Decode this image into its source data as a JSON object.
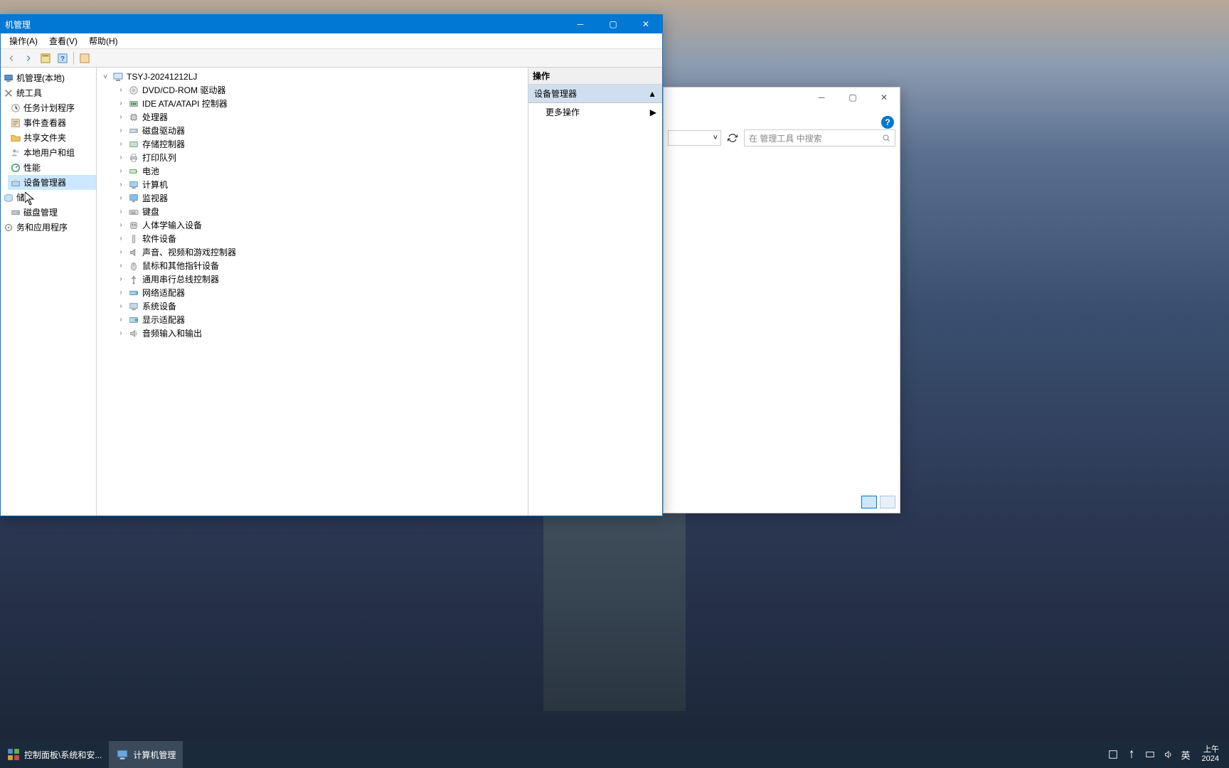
{
  "window": {
    "title": "机管理",
    "menus": {
      "action": "操作(A)",
      "view": "查看(V)",
      "help": "帮助(H)"
    }
  },
  "left_tree": {
    "root": "机管理(本地)",
    "sys_tools": "统工具",
    "items": [
      "任务计划程序",
      "事件查看器",
      "共享文件夹",
      "本地用户和组",
      "性能",
      "设备管理器"
    ],
    "storage": "储",
    "disk_mgmt": "磁盘管理",
    "services": "务和应用程序"
  },
  "device_tree": {
    "root": "TSYJ-20241212LJ",
    "categories": [
      "DVD/CD-ROM 驱动器",
      "IDE ATA/ATAPI 控制器",
      "处理器",
      "磁盘驱动器",
      "存储控制器",
      "打印队列",
      "电池",
      "计算机",
      "监视器",
      "键盘",
      "人体学输入设备",
      "软件设备",
      "声音、视频和游戏控制器",
      "鼠标和其他指针设备",
      "通用串行总线控制器",
      "网络适配器",
      "系统设备",
      "显示适配器",
      "音频输入和输出"
    ]
  },
  "right_panel": {
    "header": "操作",
    "section": "设备管理器",
    "more_actions": "更多操作"
  },
  "back_window": {
    "search_placeholder": "在 管理工具 中搜索"
  },
  "taskbar": {
    "item1": "控制面板\\系统和安...",
    "item2": "计算机管理",
    "ime": "英",
    "time_top": "上午",
    "time_bottom": "2024"
  }
}
